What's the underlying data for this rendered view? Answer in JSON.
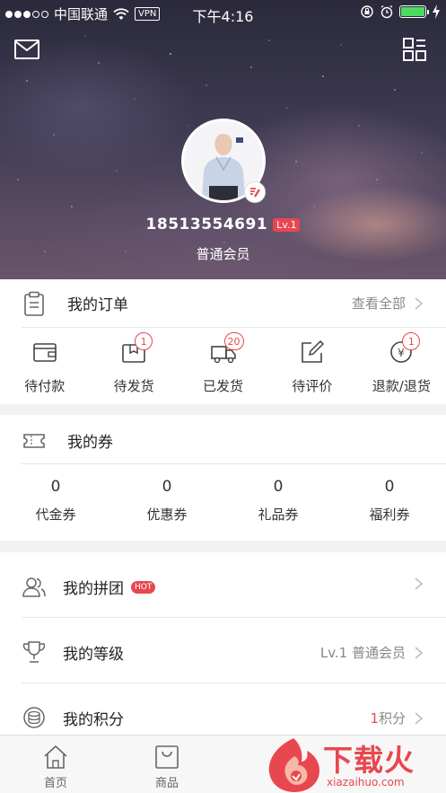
{
  "status_bar": {
    "carrier": "中国联通",
    "vpn": "VPN",
    "time": "下午4:16"
  },
  "header": {
    "mail_icon": "envelope-icon",
    "qr_icon": "qr-code-icon",
    "phone": "18513554691",
    "level": "Lv.1",
    "member_type": "普通会员"
  },
  "orders": {
    "title": "我的订单",
    "view_all": "查看全部",
    "items": [
      {
        "label": "待付款",
        "icon": "wallet-icon",
        "badge": ""
      },
      {
        "label": "待发货",
        "icon": "package-icon",
        "badge": "1"
      },
      {
        "label": "已发货",
        "icon": "truck-icon",
        "badge": "20"
      },
      {
        "label": "待评价",
        "icon": "pen-icon",
        "badge": ""
      },
      {
        "label": "退款/退货",
        "icon": "refund-icon",
        "badge": "1"
      }
    ]
  },
  "coupons": {
    "title": "我的券",
    "items": [
      {
        "count": "0",
        "label": "代金券"
      },
      {
        "count": "0",
        "label": "优惠券"
      },
      {
        "count": "0",
        "label": "礼品券"
      },
      {
        "count": "0",
        "label": "福利券"
      }
    ]
  },
  "list": {
    "group_buy": {
      "title": "我的拼团",
      "hot": "HOT"
    },
    "level": {
      "title": "我的等级",
      "value": "Lv.1 普通会员"
    },
    "points": {
      "title": "我的积分",
      "value_num": "1",
      "value_unit": "积分"
    }
  },
  "tabbar": {
    "tabs": [
      {
        "label": "首页",
        "icon": "home-icon"
      },
      {
        "label": "商品",
        "icon": "bag-icon"
      }
    ]
  },
  "watermark": {
    "brand": "下载火",
    "domain": "xiazaihuo.com"
  },
  "colors": {
    "accent_red": "#e8474f",
    "battery_green": "#4cd964"
  }
}
